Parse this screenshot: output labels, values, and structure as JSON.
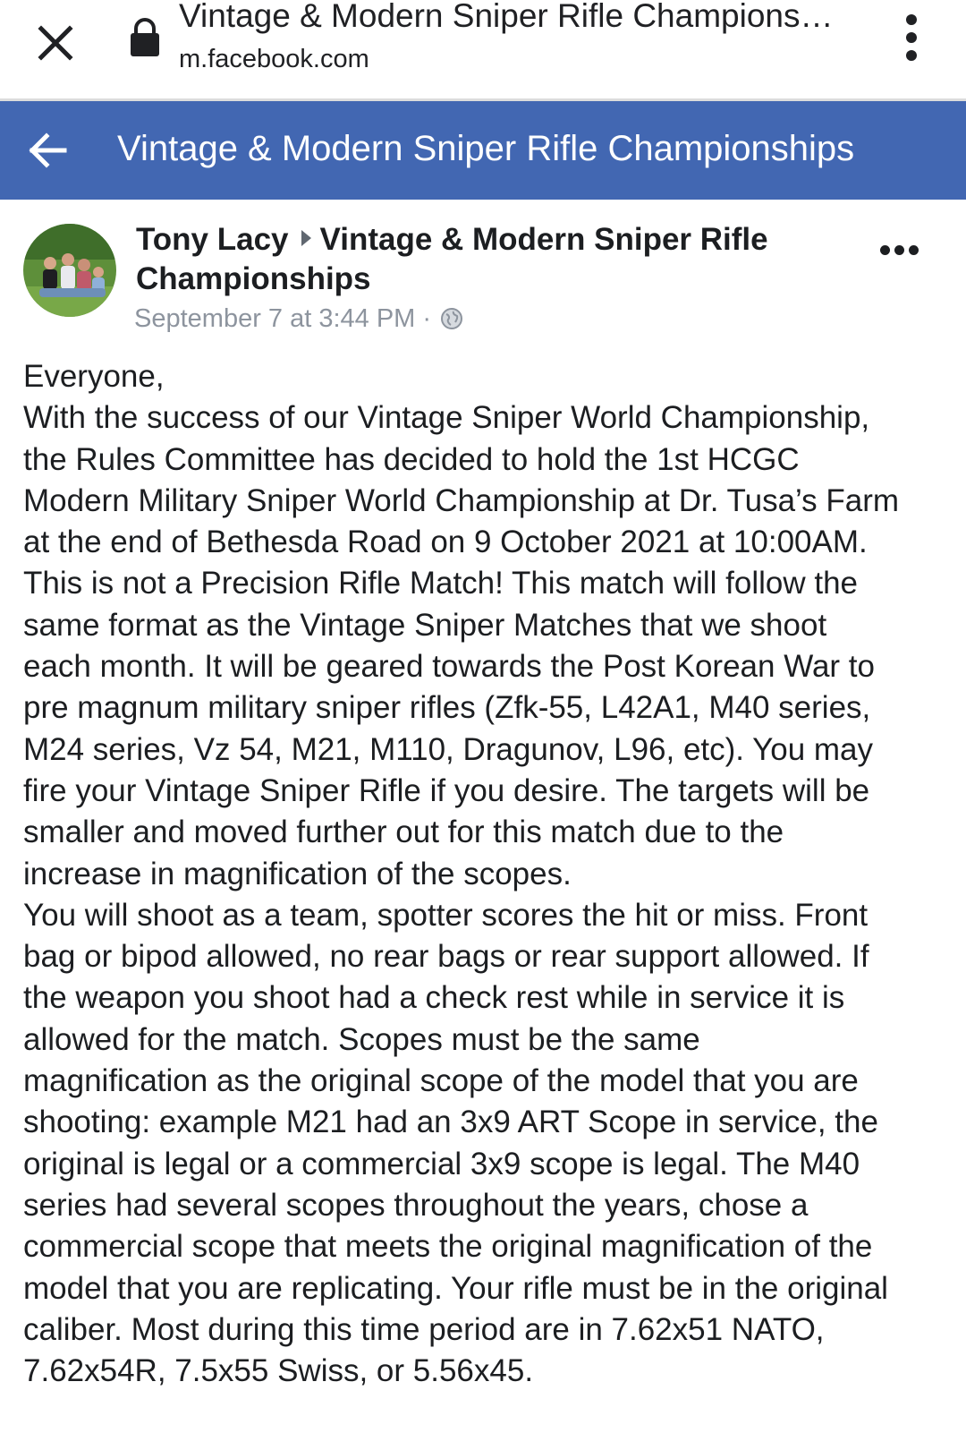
{
  "browser": {
    "title": "Vintage & Modern Sniper Rifle Championships",
    "url": "m.facebook.com"
  },
  "fb_header": {
    "title": "Vintage & Modern Sniper Rifle Championships"
  },
  "post": {
    "author": "Tony Lacy",
    "group": "Vintage & Modern Sniper Rifle Championships",
    "timestamp": "September 7 at 3:44 PM",
    "separator": "·",
    "body_lines": [
      "Everyone,",
      "With the success of our Vintage Sniper World Championship,",
      "the Rules Committee has decided to hold the 1st HCGC",
      "Modern Military Sniper World Championship at Dr. Tusa’s Farm",
      "at the end of Bethesda Road on 9 October 2021 at 10:00AM.",
      "This is not a Precision Rifle Match! This match will follow the",
      "same format as the Vintage Sniper Matches that we shoot",
      "each month. It will be geared towards the Post Korean War to",
      "pre magnum military sniper rifles (Zfk-55, L42A1, M40 series,",
      "M24 series, Vz 54, M21, M110, Dragunov, L96, etc). You may",
      "fire your Vintage Sniper Rifle if you desire. The targets will be",
      "smaller and moved further out for this match due to the",
      "increase in magnification of the scopes.",
      "You will shoot as a team, spotter scores the hit or miss. Front",
      "bag or bipod allowed, no rear bags or rear support allowed. If",
      "the weapon you shoot had a check rest while in service it is",
      "allowed for the match. Scopes must be the same",
      "magnification as the original scope of the model that you are",
      "shooting: example M21 had an 3x9 ART Scope in service, the",
      "original is legal or a commercial 3x9 scope is legal. The M40",
      "series had several scopes throughout the years, chose a",
      "commercial scope that meets the original magnification of the",
      "model that you are replicating. Your rifle must be in the original",
      "caliber. Most during this time period are in 7.62x51 NATO,",
      "7.62x54R, 7.5x55 Swiss, or 5.56x45."
    ]
  },
  "icons": {
    "close": "close-icon",
    "lock": "lock-icon",
    "menu": "more-vert-icon",
    "back": "arrow-back-icon",
    "globe": "globe-icon",
    "post_more": "more-horiz-icon"
  },
  "colors": {
    "fb_blue": "#4267b2",
    "meta_gray": "#8d949e",
    "text": "#1c1e21"
  }
}
